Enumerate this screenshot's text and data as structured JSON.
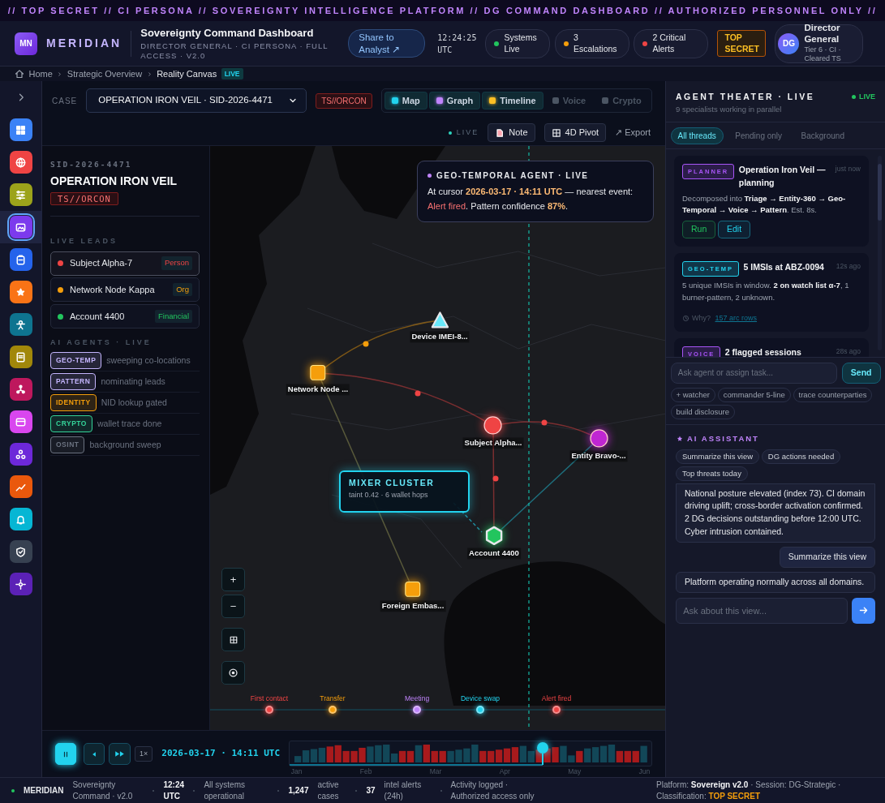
{
  "banner": "// TOP SECRET // CI PERSONA // SOVEREIGNTY INTELLIGENCE PLATFORM // DG COMMAND DASHBOARD // AUTHORIZED PERSONNEL ONLY //",
  "header": {
    "logo": "MN",
    "brand": "MERIDIAN",
    "title": "Sovereignty Command Dashboard",
    "subtitle": "DIRECTOR GENERAL · CI PERSONA · FULL ACCESS · V2.0",
    "share_button": "Share to Analyst ↗",
    "clock": "12:24:25",
    "clock_zone": "UTC",
    "statuses": [
      {
        "label": "Systems Live",
        "color": "#22c55e"
      },
      {
        "label": "3 Escalations",
        "color": "#f59e0b"
      },
      {
        "label": "2 Critical Alerts",
        "color": "#ef4444"
      }
    ],
    "classification": "TOP SECRET",
    "user": {
      "initials": "DG",
      "name": "Director General",
      "detail": "Tier 6 · CI · Cleared TS"
    }
  },
  "breadcrumb": {
    "items": [
      "Home",
      "Strategic Overview",
      "Reality Canvas"
    ],
    "badge": "LIVE"
  },
  "sidebar": {
    "items": [
      {
        "color": "#3b82f6",
        "selected": false
      },
      {
        "color": "#ef4444",
        "selected": false
      },
      {
        "color": "#9ca31b",
        "selected": false
      },
      {
        "color": "#7c3aed",
        "selected": true
      },
      {
        "color": "#2563eb",
        "selected": false
      },
      {
        "color": "#f97316",
        "selected": false
      },
      {
        "color": "#0e7490",
        "selected": false
      },
      {
        "color": "#a1870a",
        "selected": false
      },
      {
        "color": "#be185d",
        "selected": false
      },
      {
        "color": "#d946ef",
        "selected": false
      },
      {
        "color": "#6d28d9",
        "selected": false
      },
      {
        "color": "#ea580c",
        "selected": false
      },
      {
        "color": "#06b6d4",
        "selected": false
      },
      {
        "color": "#374151",
        "selected": false
      },
      {
        "color": "#5b21b6",
        "selected": false
      }
    ]
  },
  "case_bar": {
    "label": "CASE",
    "case": "OPERATION IRON VEIL · SID-2026-4471",
    "classification": "TS//ORCON",
    "views": [
      {
        "label": "Map",
        "color": "#22d3ee",
        "on": true
      },
      {
        "label": "Graph",
        "color": "#c084fc",
        "on": true
      },
      {
        "label": "Timeline",
        "color": "#fbbf24",
        "on": true
      },
      {
        "label": "Voice",
        "color": "#4b5563",
        "on": false
      },
      {
        "label": "Crypto",
        "color": "#4b5563",
        "on": false
      }
    ],
    "live": "LIVE",
    "note": "Note",
    "pivot": "4D Pivot",
    "export": "↗ Export"
  },
  "case_panel": {
    "id": "SID-2026-4471",
    "title": "OPERATION IRON VEIL",
    "classification": "TS//ORCON",
    "leads_heading": "LIVE LEADS",
    "leads": [
      {
        "name": "Subject Alpha-7",
        "tag": "Person",
        "color": "#ef4444",
        "selected": true
      },
      {
        "name": "Network Node Kappa",
        "tag": "Org",
        "color": "#f59e0b",
        "selected": false
      },
      {
        "name": "Account 4400",
        "tag": "Financial",
        "color": "#22c55e",
        "selected": false
      }
    ],
    "agents_heading": "AI AGENTS · LIVE",
    "agents": [
      {
        "tag": "GEO-TEMP",
        "status": "sweeping co-locations",
        "color": "#c4b5fd"
      },
      {
        "tag": "PATTERN",
        "status": "nominating leads",
        "color": "#c4b5fd"
      },
      {
        "tag": "IDENTITY",
        "status": "NID lookup gated",
        "color": "#f59e0b"
      },
      {
        "tag": "CRYPTO",
        "status": "wallet trace done",
        "color": "#34d399"
      },
      {
        "tag": "OSINT",
        "status": "background sweep",
        "color": "#6b7280"
      }
    ]
  },
  "map": {
    "tooltip": {
      "title": "GEO-TEMPORAL AGENT · LIVE",
      "parts": [
        {
          "kind": "plain",
          "text": "At cursor "
        },
        {
          "kind": "highlight",
          "text": "2026-03-17 · 14:11 UTC"
        },
        {
          "kind": "plain",
          "text": " — nearest event: "
        },
        {
          "kind": "alert",
          "text": "Alert fired"
        },
        {
          "kind": "plain",
          "text": ". Pattern confidence "
        },
        {
          "kind": "highlight",
          "text": "87%"
        },
        {
          "kind": "plain",
          "text": "."
        }
      ]
    },
    "nodes": [
      {
        "label": "Device IMEI-8...",
        "kind": "triangle",
        "color": "#67e8f9"
      },
      {
        "label": "Network Node ...",
        "kind": "square",
        "color": "#f59e0b"
      },
      {
        "label": "Subject Alpha...",
        "kind": "circle",
        "color": "#ef4444"
      },
      {
        "label": "Entity Bravo-...",
        "kind": "circle",
        "color": "#c026d3"
      },
      {
        "label": "Account 4400",
        "kind": "hexagon",
        "color": "#22c55e"
      },
      {
        "label": "Foreign Embas...",
        "kind": "square",
        "color": "#f59e0b"
      }
    ],
    "cluster": {
      "title": "MIXER CLUSTER",
      "detail": "taint 0.42 · 6 wallet hops"
    },
    "zoom": [
      "+",
      "−"
    ],
    "events": [
      {
        "label": "First contact",
        "color": "#ef4444"
      },
      {
        "label": "Transfer",
        "color": "#f59e0b"
      },
      {
        "label": "Meeting",
        "color": "#c084fc"
      },
      {
        "label": "Device swap",
        "color": "#22d3ee"
      },
      {
        "label": "Alert fired",
        "color": "#ef4444"
      }
    ]
  },
  "timeline": {
    "playing": true,
    "speed": "1×",
    "time": "2026-03-17 · 14:11 UTC",
    "level": 0.7,
    "months": [
      "Jan",
      "Feb",
      "Mar",
      "Apr",
      "May",
      "Jun"
    ]
  },
  "agent_theater": {
    "title": "AGENT THEATER · LIVE",
    "subtitle": "9 specialists working in parallel",
    "live": "LIVE",
    "filters": [
      {
        "label": "All threads",
        "selected": true
      },
      {
        "label": "Pending only",
        "selected": false
      },
      {
        "label": "Background",
        "selected": false
      }
    ],
    "threads": [
      {
        "tag": "PLANNER",
        "color": "#a855f7",
        "title": "Operation Iron Veil — planning",
        "time": "just now",
        "body": "Decomposed into **Triage → Entity-360 → Geo-Temporal → Voice → Pattern**. Est. 8s.",
        "actions": [
          {
            "label": "Run",
            "color": "#22c55e"
          },
          {
            "label": "Edit",
            "color": "#22d3ee"
          }
        ]
      },
      {
        "tag": "GEO-TEMP",
        "color": "#22d3ee",
        "title": "5 IMSIs at ABZ-0094",
        "time": "12s ago",
        "body": "5 unique IMSIs in window. **2 on watch list α-7**, 1 burner-pattern, 2 unknown.",
        "why": "Why?",
        "link": "157 arc rows"
      },
      {
        "tag": "VOICE",
        "color": "#a855f7",
        "title": "2 flagged sessions",
        "time": "28s ago"
      }
    ],
    "placeholder": "Ask agent or assign task...",
    "send": "Send",
    "chips": [
      "+ watcher",
      "commander 5-line",
      "trace counterparties",
      "build disclosure"
    ]
  },
  "assistant": {
    "title": "AI ASSISTANT",
    "prompts": [
      "Summarize this view",
      "DG actions needed",
      "Top threats today"
    ],
    "messages": [
      {
        "kind": "assistant",
        "text": "National posture elevated (index 73). CI domain driving uplift; cross-border activation confirmed. 2 DG decisions outstanding before 12:00 UTC. Cyber intrusion contained."
      },
      {
        "kind": "user",
        "text": "Summarize this view"
      },
      {
        "kind": "assistant",
        "text": "Platform operating normally across all domains."
      }
    ],
    "placeholder": "Ask about this view..."
  },
  "footer": {
    "brand": "MERIDIAN",
    "items": [
      {
        "kind": "text",
        "text": "Sovereignty Command · v2.0"
      },
      {
        "kind": "strong",
        "text": "12:24 UTC"
      },
      {
        "kind": "text",
        "text": "All systems operational"
      },
      {
        "kind": "strong",
        "text": "1,247"
      },
      {
        "kind": "text",
        "text": "active cases"
      },
      {
        "kind": "strong",
        "text": "37"
      },
      {
        "kind": "text",
        "text": "intel alerts (24h)"
      },
      {
        "kind": "text",
        "text": "Activity logged · Authorized access only"
      }
    ],
    "platform": "Platform: **Sovereign v2.0** · Session: DG-Strategic · Classification: ",
    "classification": "TOP SECRET"
  }
}
